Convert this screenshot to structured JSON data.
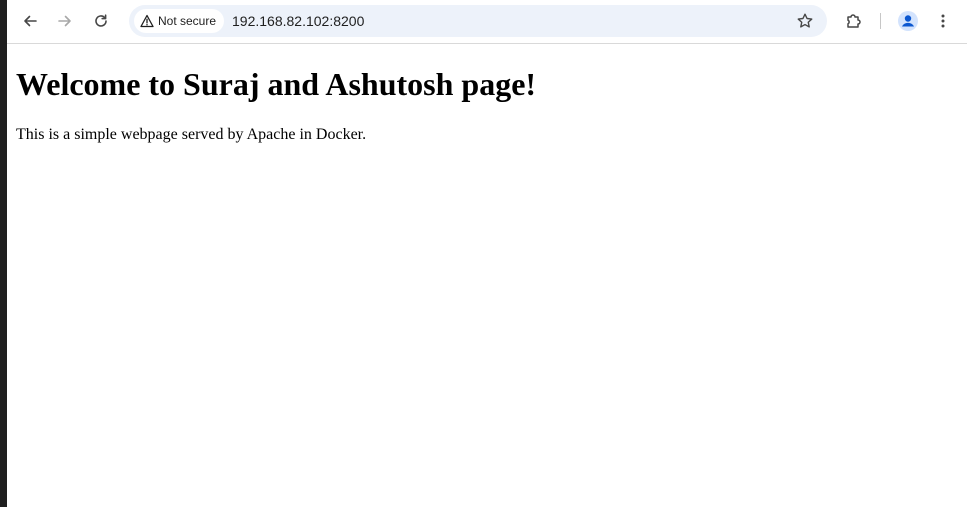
{
  "browser": {
    "nav": {
      "back_icon": "arrow-left-icon",
      "forward_icon": "arrow-right-icon",
      "reload_icon": "reload-icon"
    },
    "omnibox": {
      "security_label": "Not secure",
      "security_icon": "warning-triangle-icon",
      "url": "192.168.82.102:8200",
      "bookmark_icon": "star-icon"
    },
    "actions": {
      "extensions_icon": "puzzle-icon",
      "profile_icon": "person-icon",
      "menu_icon": "kebab-menu-icon"
    },
    "colors": {
      "omnibox_bg": "#edf2fa",
      "profile_accent": "#0b57d0"
    }
  },
  "page": {
    "heading": "Welcome to Suraj and Ashutosh page!",
    "paragraph": "This is a simple webpage served by Apache in Docker."
  }
}
